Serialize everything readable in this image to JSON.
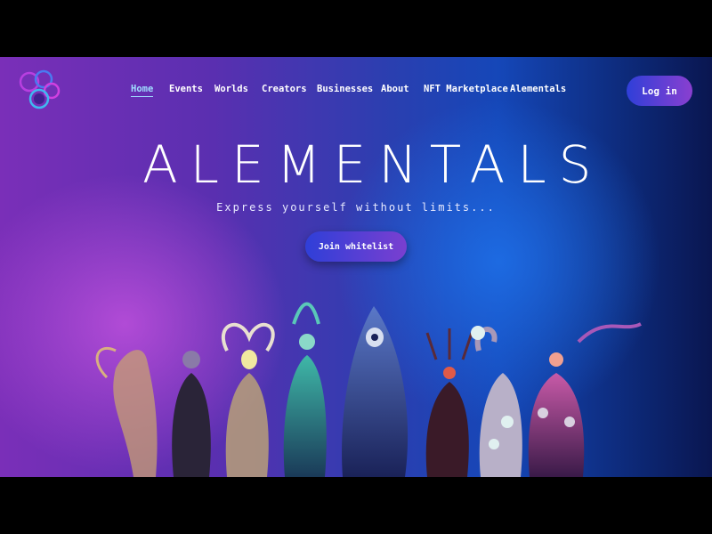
{
  "header": {
    "nav": [
      {
        "label": "Home",
        "active": true
      },
      {
        "label": "Events"
      },
      {
        "label": "Worlds"
      },
      {
        "label": "Creators"
      },
      {
        "label": "Businesses"
      },
      {
        "label": "About"
      },
      {
        "label": "NFT Marketplace"
      },
      {
        "label": "Alementals"
      }
    ],
    "login_label": "Log in"
  },
  "hero": {
    "brand": "ALEMENTALS",
    "tagline": "Express yourself without limits...",
    "cta_label": "Join whitelist"
  },
  "colors": {
    "accent_blue": "#2f3fd8",
    "accent_purple": "#8a3fd0",
    "nav_active": "#9fdcff"
  }
}
